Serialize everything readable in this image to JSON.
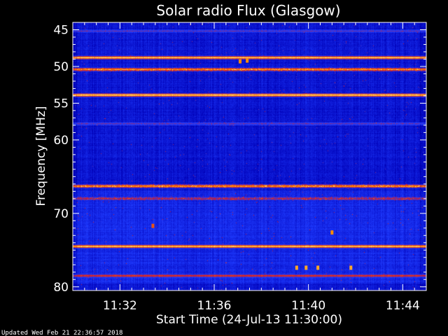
{
  "chart_data": {
    "type": "heatmap",
    "title": "Solar radio Flux (Glasgow)",
    "xlabel": "Start Time (24-Jul-13 11:30:00)",
    "ylabel": "Frequency [MHz]",
    "x_ticks": [
      "11:32",
      "11:36",
      "11:40",
      "11:44"
    ],
    "x_tick_minutes": [
      2,
      6,
      10,
      14
    ],
    "xlim_minutes_after_start": [
      0,
      15
    ],
    "y_ticks": [
      "45",
      "50",
      "55",
      "60",
      "70",
      "80"
    ],
    "y_tick_values": [
      45,
      50,
      55,
      60,
      70,
      80
    ],
    "ylim": [
      44,
      80.5
    ],
    "y_reversed": true,
    "colormap": [
      "#000060",
      "#0000b8",
      "#1f3cff",
      "#d11a2a",
      "#ff8c00",
      "#fff7a0"
    ],
    "background_level": 0.27,
    "bands": [
      {
        "freq_mhz": 45.2,
        "level": 0.47
      },
      {
        "freq_mhz": 48.8,
        "level": 0.96
      },
      {
        "freq_mhz": 50.4,
        "level": 0.82,
        "spiky": true
      },
      {
        "freq_mhz": 53.9,
        "level": 1.0
      },
      {
        "freq_mhz": 57.8,
        "level": 0.48
      },
      {
        "freq_mhz": 66.3,
        "level": 0.84,
        "spiky": true
      },
      {
        "freq_mhz": 68.0,
        "level": 0.58,
        "spiky": true
      },
      {
        "freq_mhz": 74.5,
        "level": 1.0
      },
      {
        "freq_mhz": 78.5,
        "level": 0.66
      }
    ],
    "bursts": [
      {
        "minute": 11.0,
        "freq_mhz": 72.6,
        "level": 0.8
      },
      {
        "minute": 9.5,
        "freq_mhz": 77.4,
        "level": 0.85
      },
      {
        "minute": 9.9,
        "freq_mhz": 77.4,
        "level": 0.85
      },
      {
        "minute": 10.4,
        "freq_mhz": 77.4,
        "level": 0.85
      },
      {
        "minute": 11.8,
        "freq_mhz": 77.4,
        "level": 0.85
      },
      {
        "minute": 7.1,
        "freq_mhz": 49.3,
        "level": 0.8
      },
      {
        "minute": 7.4,
        "freq_mhz": 49.2,
        "level": 0.8
      },
      {
        "minute": 3.4,
        "freq_mhz": 71.7,
        "level": 0.7
      }
    ]
  },
  "footer": {
    "updated": "Updated Wed Feb 21 22:36:57 2018"
  }
}
